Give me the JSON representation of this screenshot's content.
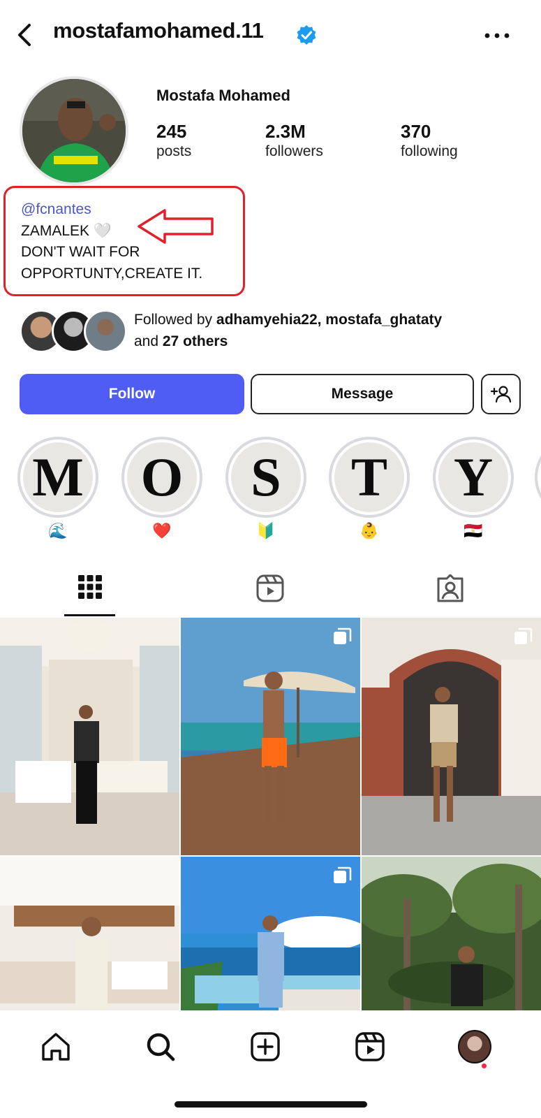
{
  "header": {
    "username": "mostafamohamed.11",
    "verified": true,
    "back_icon": "chevron-left-icon",
    "more_icon": "more-horizontal-icon"
  },
  "profile": {
    "full_name": "Mostafa Mohamed",
    "stats": [
      {
        "value": "245",
        "label": "posts"
      },
      {
        "value": "2.3M",
        "label": "followers"
      },
      {
        "value": "370",
        "label": "following"
      }
    ]
  },
  "bio": {
    "link": "@fcnantes",
    "line1": "ZAMALEK 🤍",
    "line2": "DON'T WAIT FOR",
    "line3": "OPPORTUNTY,CREATE IT."
  },
  "followed_by": {
    "prefix": "Followed by ",
    "names": "adhamyehia22, mostafa_ghataty",
    "mid": "and ",
    "others": "27 others"
  },
  "actions": {
    "follow_label": "Follow",
    "message_label": "Message",
    "suggest_icon": "add-person-icon"
  },
  "highlights": [
    {
      "letter": "M",
      "label": "🌊"
    },
    {
      "letter": "O",
      "label": "❤️"
    },
    {
      "letter": "S",
      "label": "🔰"
    },
    {
      "letter": "T",
      "label": "👶"
    },
    {
      "letter": "Y",
      "label": "🇪🇬"
    }
  ],
  "tabs": [
    {
      "icon": "grid-icon",
      "active": true
    },
    {
      "icon": "reels-icon",
      "active": false
    },
    {
      "icon": "tagged-icon",
      "active": false
    }
  ],
  "bottom_nav": [
    {
      "icon": "home-icon"
    },
    {
      "icon": "search-icon"
    },
    {
      "icon": "create-icon"
    },
    {
      "icon": "reels-icon"
    },
    {
      "icon": "profile-avatar"
    }
  ],
  "colors": {
    "follow_button": "#4f5df5",
    "link": "#4a57c9",
    "annotation": "#e0202a",
    "verified": "#1d9bf0"
  }
}
